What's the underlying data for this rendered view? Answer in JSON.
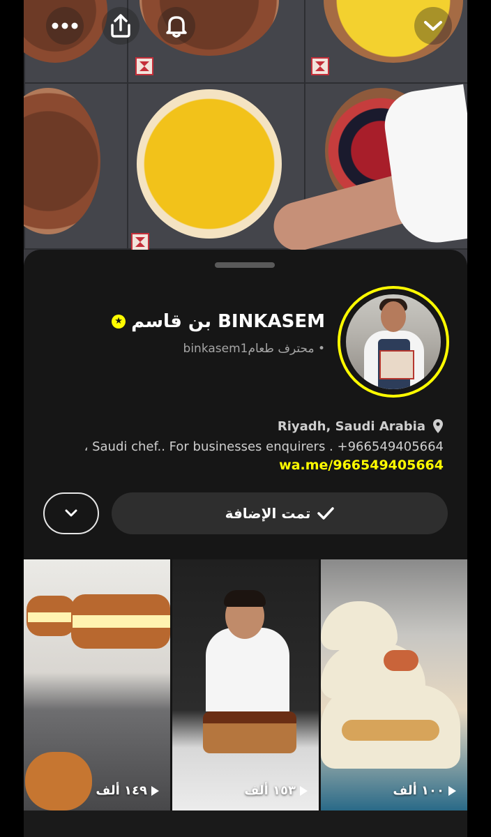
{
  "profile": {
    "display_name": "بن قاسم BINKASEM",
    "handle_line": "binkasem1محترف طعام •",
    "location": "Riyadh, Saudi Arabia",
    "bio": "، Saudi chef.. For businesses enquirers . +966549405664",
    "link": "wa.me/966549405664"
  },
  "actions": {
    "added_label": "تمت الإضافة"
  },
  "stories": [
    {
      "views": "١٤٩ ألف"
    },
    {
      "views": "١٥٣ ألف"
    },
    {
      "views": "١٠٠ ألف"
    }
  ],
  "icons": {
    "more": "more-horizontal-icon",
    "share": "share-upload-icon",
    "bell": "bell-icon",
    "collapse": "chevron-down-icon",
    "star": "star-icon",
    "pin": "location-pin-icon",
    "check": "checkmark-icon"
  },
  "colors": {
    "accent": "#fffc00",
    "sheet_bg": "#161616",
    "button_bg": "#2e2e2e"
  }
}
